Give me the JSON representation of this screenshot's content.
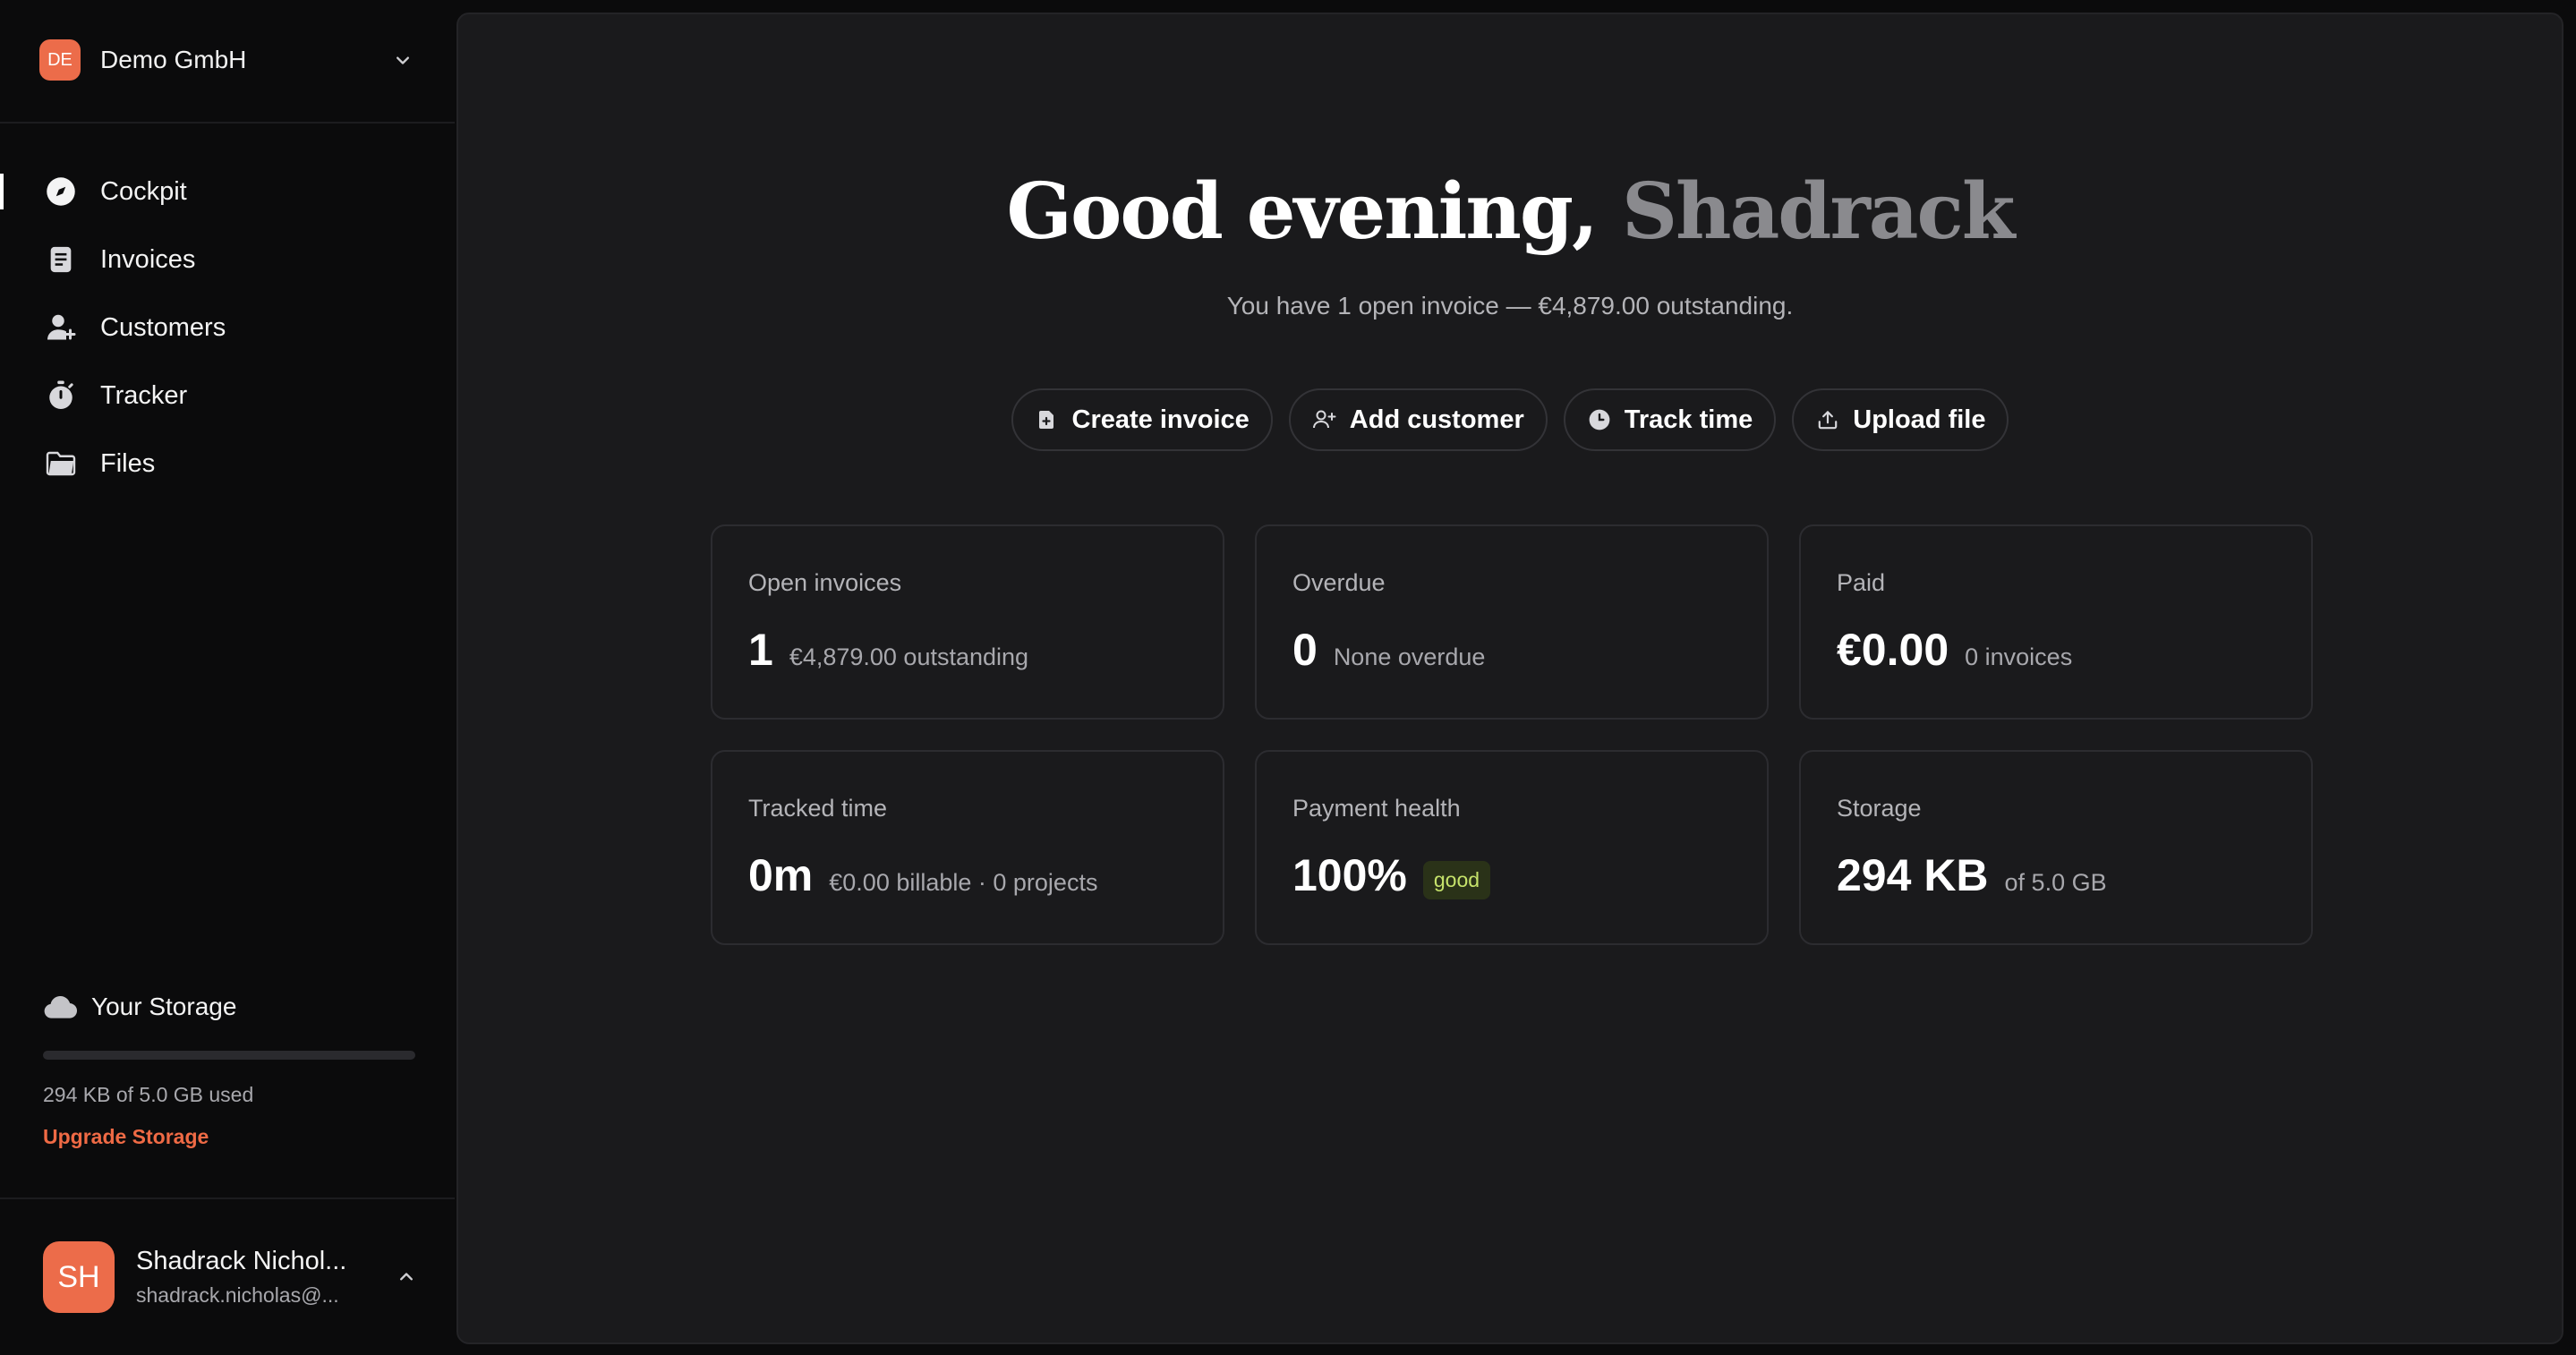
{
  "org": {
    "initials": "DE",
    "name": "Demo GmbH"
  },
  "nav": [
    {
      "label": "Cockpit",
      "icon": "compass-icon",
      "active": true
    },
    {
      "label": "Invoices",
      "icon": "receipt-icon",
      "active": false
    },
    {
      "label": "Customers",
      "icon": "users-icon",
      "active": false
    },
    {
      "label": "Tracker",
      "icon": "stopwatch-icon",
      "active": false
    },
    {
      "label": "Files",
      "icon": "folder-icon",
      "active": false
    }
  ],
  "storage": {
    "title": "Your Storage",
    "used_text": "294 KB of 5.0 GB used",
    "used_fraction": 0.0001,
    "upgrade_label": "Upgrade Storage"
  },
  "user": {
    "initials": "SH",
    "name": "Shadrack Nichol...",
    "email": "shadrack.nicholas@..."
  },
  "greeting": {
    "prefix": "Good evening,",
    "name": "Shadrack"
  },
  "subtitle": "You have 1 open invoice — €4,879.00 outstanding.",
  "actions": [
    {
      "label": "Create invoice",
      "icon": "file-plus-icon"
    },
    {
      "label": "Add customer",
      "icon": "user-plus-icon"
    },
    {
      "label": "Track time",
      "icon": "clock-icon"
    },
    {
      "label": "Upload file",
      "icon": "upload-icon"
    }
  ],
  "cards": [
    {
      "title": "Open invoices",
      "value": "1",
      "note": "€4,879.00 outstanding"
    },
    {
      "title": "Overdue",
      "value": "0",
      "note": "None overdue"
    },
    {
      "title": "Paid",
      "value": "€0.00",
      "note": "0 invoices"
    },
    {
      "title": "Tracked time",
      "value": "0m",
      "note": "€0.00 billable · 0 projects"
    },
    {
      "title": "Payment health",
      "value": "100%",
      "badge": "good"
    },
    {
      "title": "Storage",
      "value": "294 KB",
      "note": "of 5.0 GB"
    }
  ],
  "colors": {
    "accent": "#ec6c4a",
    "upgrade_link": "#ef6a45",
    "good_badge_text": "#c6e36b"
  }
}
